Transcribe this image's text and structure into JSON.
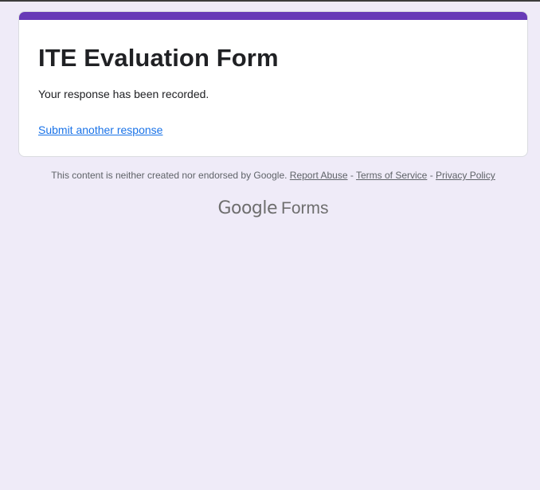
{
  "form": {
    "title": "ITE Evaluation Form",
    "confirmation_message": "Your response has been recorded.",
    "submit_another_label": "Submit another response",
    "accent_color": "#673ab7"
  },
  "footer": {
    "disclaimer": "This content is neither created nor endorsed by Google.",
    "separator": "-",
    "report_abuse_label": "Report Abuse",
    "terms_label": "Terms of Service",
    "privacy_label": "Privacy Policy"
  },
  "branding": {
    "google_text": "Google",
    "product_text": "Forms"
  },
  "colors": {
    "background": "#efebf8",
    "link": "#1a73e8"
  }
}
